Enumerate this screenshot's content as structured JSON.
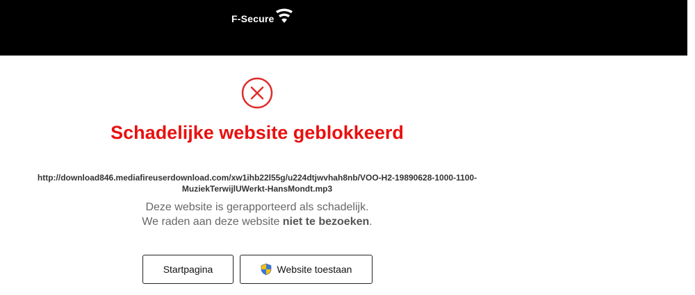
{
  "header": {
    "brand": "F-Secure",
    "logo_icon": "f-secure-wifi-shield-icon",
    "background": "#000000"
  },
  "alert": {
    "icon": "error-x-circle-icon",
    "title": "Schadelijke website geblokkeerd",
    "title_color": "#e8100f",
    "url_line1": "http://download846.mediafireuserdownload.com/xw1ihb22l55g/u224dtjwvhah8nb/VOO-H2-19890628-1000-1100-",
    "url_line2": "MuziekTerwijlUWerkt-HansMondt.mp3",
    "desc_line1": "Deze website is gerapporteerd als schadelijk.",
    "desc_line2_prefix": "We raden aan deze website ",
    "desc_line2_bold": "niet te bezoeken",
    "desc_line2_suffix": "."
  },
  "buttons": {
    "home_label": "Startpagina",
    "allow_label": "Website toestaan",
    "allow_icon": "uac-shield-icon"
  }
}
